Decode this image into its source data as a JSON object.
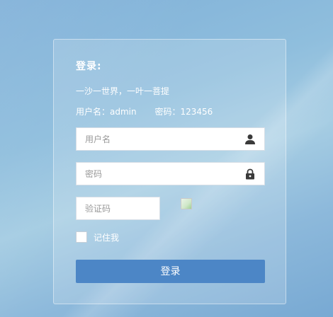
{
  "login": {
    "title": "登录:",
    "motto": "一沙一世界，一叶一菩提",
    "hint_username": "用户名：admin",
    "hint_password": "密码：123456",
    "username_placeholder": "用户名",
    "password_placeholder": "密码",
    "captcha_placeholder": "验证码",
    "remember_label": "记住我",
    "submit_label": "登录"
  },
  "icons": {
    "username": "user-icon",
    "password": "lock-icon",
    "captcha": "broken-image-icon"
  },
  "colors": {
    "button": "#4c86c6",
    "background": "#8fbedd",
    "text": "#ffffff"
  }
}
